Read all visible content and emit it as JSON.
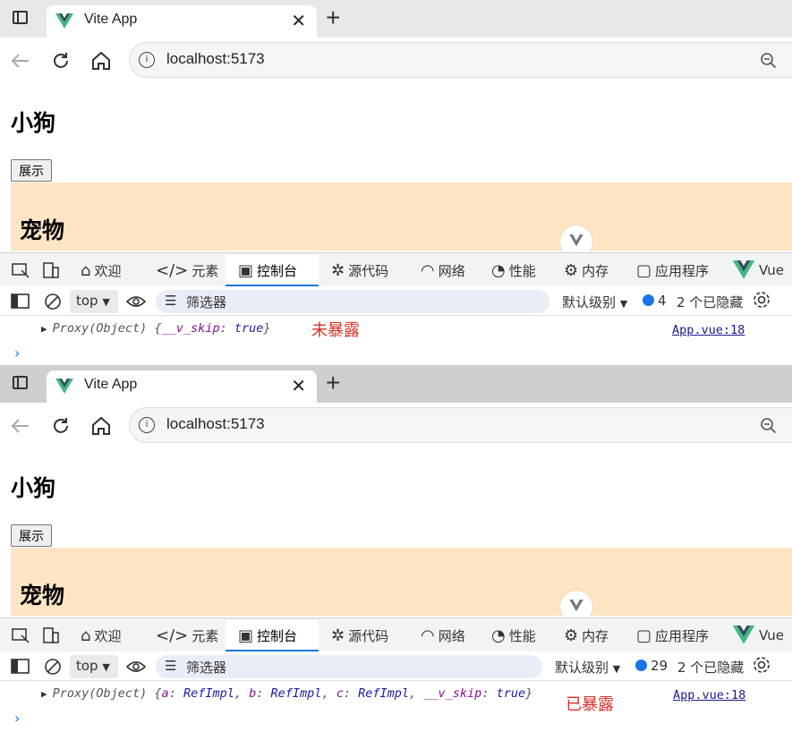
{
  "colors": {
    "accent": "#1a73e8",
    "vue_green": "#42b883",
    "vue_dark": "#35495e",
    "pet_bg": "#fde5c4",
    "annotation": "#d93025"
  },
  "shots": [
    {
      "tab_title": "Vite App",
      "url": "localhost:5173",
      "page": {
        "heading": "小狗",
        "button_label": "展示",
        "pet_heading": "宠物"
      },
      "devtools_tabs": [
        "欢迎",
        "元素",
        "控制台",
        "源代码",
        "网络",
        "性能",
        "内存",
        "应用程序",
        "Vue"
      ],
      "console_toolbar": {
        "context": "top",
        "filter_placeholder": "筛选器",
        "level": "默认级别",
        "message_count": "4",
        "hidden": "2 个已隐藏"
      },
      "log": {
        "prefix": "Proxy(Object) {",
        "entries": [
          {
            "key": "__v_skip",
            "value": "true"
          }
        ],
        "suffix": "}",
        "source": "App.vue:18",
        "annotation": "未暴露"
      }
    },
    {
      "tab_title": "Vite App",
      "url": "localhost:5173",
      "page": {
        "heading": "小狗",
        "button_label": "展示",
        "pet_heading": "宠物"
      },
      "devtools_tabs": [
        "欢迎",
        "元素",
        "控制台",
        "源代码",
        "网络",
        "性能",
        "内存",
        "应用程序",
        "Vue"
      ],
      "console_toolbar": {
        "context": "top",
        "filter_placeholder": "筛选器",
        "level": "默认级别",
        "message_count": "29",
        "hidden": "2 个已隐藏"
      },
      "log": {
        "prefix": "Proxy(Object) {",
        "entries": [
          {
            "key": "a",
            "value": "RefImpl"
          },
          {
            "key": "b",
            "value": "RefImpl"
          },
          {
            "key": "c",
            "value": "RefImpl"
          },
          {
            "key": "__v_skip",
            "value": "true"
          }
        ],
        "suffix": "}",
        "source": "App.vue:18",
        "annotation": "已暴露"
      }
    }
  ]
}
